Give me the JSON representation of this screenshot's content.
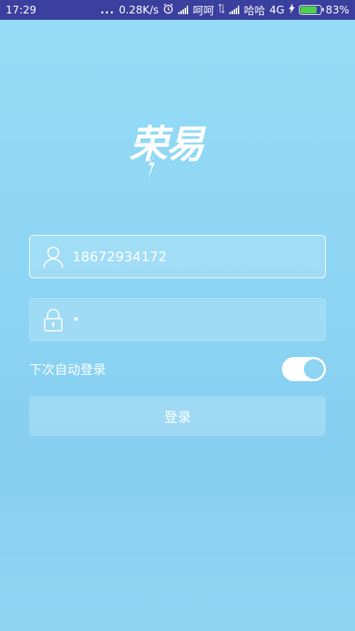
{
  "status_bar": {
    "time": "17:29",
    "dots": "...",
    "speed": "0.28K/s",
    "carrier1": "呵呵",
    "carrier2": "哈哈",
    "network": "4G",
    "battery": "83%"
  },
  "logo": {
    "text": "荣易"
  },
  "login": {
    "username_value": "18672934172",
    "password_mask": "•",
    "auto_login_label": "下次自动登录",
    "auto_login_on": true,
    "login_button": "登录"
  },
  "colors": {
    "status_bar_bg": "#3b3f9e",
    "background": "#8ed6f4",
    "battery_fill": "#4fd04a"
  }
}
